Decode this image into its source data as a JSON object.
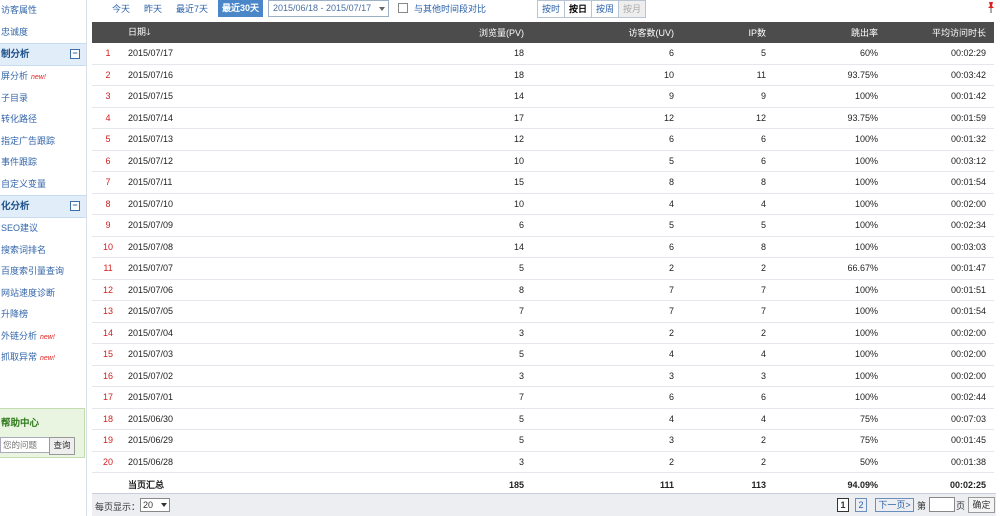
{
  "sidebar": {
    "items_top": [
      {
        "label": "访客属性",
        "new": false
      },
      {
        "label": "忠诚度",
        "new": false
      }
    ],
    "group1": {
      "title": "制分析",
      "toggle": "⊟"
    },
    "group1_items": [
      {
        "label": "屏分析",
        "new": true
      },
      {
        "label": "子目录",
        "new": false
      },
      {
        "label": "转化路径",
        "new": false
      },
      {
        "label": "指定广告跟踪",
        "new": false
      },
      {
        "label": "事件跟踪",
        "new": false
      },
      {
        "label": "自定义变量",
        "new": false
      }
    ],
    "group2": {
      "title": "化分析",
      "toggle": "⊟"
    },
    "group2_items": [
      {
        "label": "SEO建议",
        "new": false
      },
      {
        "label": "搜索词排名",
        "new": false
      },
      {
        "label": "百度索引量查询",
        "new": false
      },
      {
        "label": "网站速度诊断",
        "new": false
      },
      {
        "label": "升降榜",
        "new": false
      },
      {
        "label": "外链分析",
        "new": true
      },
      {
        "label": "抓取异常",
        "new": true
      }
    ],
    "new_badge": "new!",
    "help": {
      "title": "帮助中心",
      "placeholder": "您的问题",
      "button": "查询"
    }
  },
  "toolbar": {
    "today": "今天",
    "yesterday": "昨天",
    "last7": "最近7天",
    "last30": "最近30天",
    "daterange": "2015/06/18 - 2015/07/17",
    "compare_label": "与其他时间段对比",
    "granularity": [
      "按时",
      "按日",
      "按周",
      "按月"
    ]
  },
  "table": {
    "headers": {
      "date": "日期",
      "pv": "浏览量(PV)",
      "uv": "访客数(UV)",
      "ip": "IP数",
      "bounce": "跳出率",
      "avg_time": "平均访问时长"
    },
    "sort_arrow": "🡓",
    "rows": [
      {
        "idx": "1",
        "date": "2015/07/17",
        "pv": "18",
        "uv": "6",
        "ip": "5",
        "bounce": "60%",
        "avg_time": "00:02:29"
      },
      {
        "idx": "2",
        "date": "2015/07/16",
        "pv": "18",
        "uv": "10",
        "ip": "11",
        "bounce": "93.75%",
        "avg_time": "00:03:42"
      },
      {
        "idx": "3",
        "date": "2015/07/15",
        "pv": "14",
        "uv": "9",
        "ip": "9",
        "bounce": "100%",
        "avg_time": "00:01:42"
      },
      {
        "idx": "4",
        "date": "2015/07/14",
        "pv": "17",
        "uv": "12",
        "ip": "12",
        "bounce": "93.75%",
        "avg_time": "00:01:59"
      },
      {
        "idx": "5",
        "date": "2015/07/13",
        "pv": "12",
        "uv": "6",
        "ip": "6",
        "bounce": "100%",
        "avg_time": "00:01:32"
      },
      {
        "idx": "6",
        "date": "2015/07/12",
        "pv": "10",
        "uv": "5",
        "ip": "6",
        "bounce": "100%",
        "avg_time": "00:03:12"
      },
      {
        "idx": "7",
        "date": "2015/07/11",
        "pv": "15",
        "uv": "8",
        "ip": "8",
        "bounce": "100%",
        "avg_time": "00:01:54"
      },
      {
        "idx": "8",
        "date": "2015/07/10",
        "pv": "10",
        "uv": "4",
        "ip": "4",
        "bounce": "100%",
        "avg_time": "00:02:00"
      },
      {
        "idx": "9",
        "date": "2015/07/09",
        "pv": "6",
        "uv": "5",
        "ip": "5",
        "bounce": "100%",
        "avg_time": "00:02:34"
      },
      {
        "idx": "10",
        "date": "2015/07/08",
        "pv": "14",
        "uv": "6",
        "ip": "8",
        "bounce": "100%",
        "avg_time": "00:03:03"
      },
      {
        "idx": "11",
        "date": "2015/07/07",
        "pv": "5",
        "uv": "2",
        "ip": "2",
        "bounce": "66.67%",
        "avg_time": "00:01:47"
      },
      {
        "idx": "12",
        "date": "2015/07/06",
        "pv": "8",
        "uv": "7",
        "ip": "7",
        "bounce": "100%",
        "avg_time": "00:01:51"
      },
      {
        "idx": "13",
        "date": "2015/07/05",
        "pv": "7",
        "uv": "7",
        "ip": "7",
        "bounce": "100%",
        "avg_time": "00:01:54"
      },
      {
        "idx": "14",
        "date": "2015/07/04",
        "pv": "3",
        "uv": "2",
        "ip": "2",
        "bounce": "100%",
        "avg_time": "00:02:00"
      },
      {
        "idx": "15",
        "date": "2015/07/03",
        "pv": "5",
        "uv": "4",
        "ip": "4",
        "bounce": "100%",
        "avg_time": "00:02:00"
      },
      {
        "idx": "16",
        "date": "2015/07/02",
        "pv": "3",
        "uv": "3",
        "ip": "3",
        "bounce": "100%",
        "avg_time": "00:02:00"
      },
      {
        "idx": "17",
        "date": "2015/07/01",
        "pv": "7",
        "uv": "6",
        "ip": "6",
        "bounce": "100%",
        "avg_time": "00:02:44"
      },
      {
        "idx": "18",
        "date": "2015/06/30",
        "pv": "5",
        "uv": "4",
        "ip": "4",
        "bounce": "75%",
        "avg_time": "00:07:03"
      },
      {
        "idx": "19",
        "date": "2015/06/29",
        "pv": "5",
        "uv": "3",
        "ip": "2",
        "bounce": "75%",
        "avg_time": "00:01:45"
      },
      {
        "idx": "20",
        "date": "2015/06/28",
        "pv": "3",
        "uv": "2",
        "ip": "2",
        "bounce": "50%",
        "avg_time": "00:01:38"
      }
    ],
    "total": {
      "label": "当页汇总",
      "pv": "185",
      "uv": "111",
      "ip": "113",
      "bounce": "94.09%",
      "avg_time": "00:02:25"
    }
  },
  "footer": {
    "per_page_label": "每页显示：",
    "per_page_value": "20",
    "current_page": "1",
    "page2": "2",
    "next": "下一页>",
    "jump_prefix": "第",
    "jump_suffix": "页",
    "confirm": "确定"
  },
  "colors": {
    "accent": "#4a86c8",
    "header_bg": "#4c4c4c",
    "index_red": "#d02020",
    "link_blue": "#2a60a8"
  }
}
